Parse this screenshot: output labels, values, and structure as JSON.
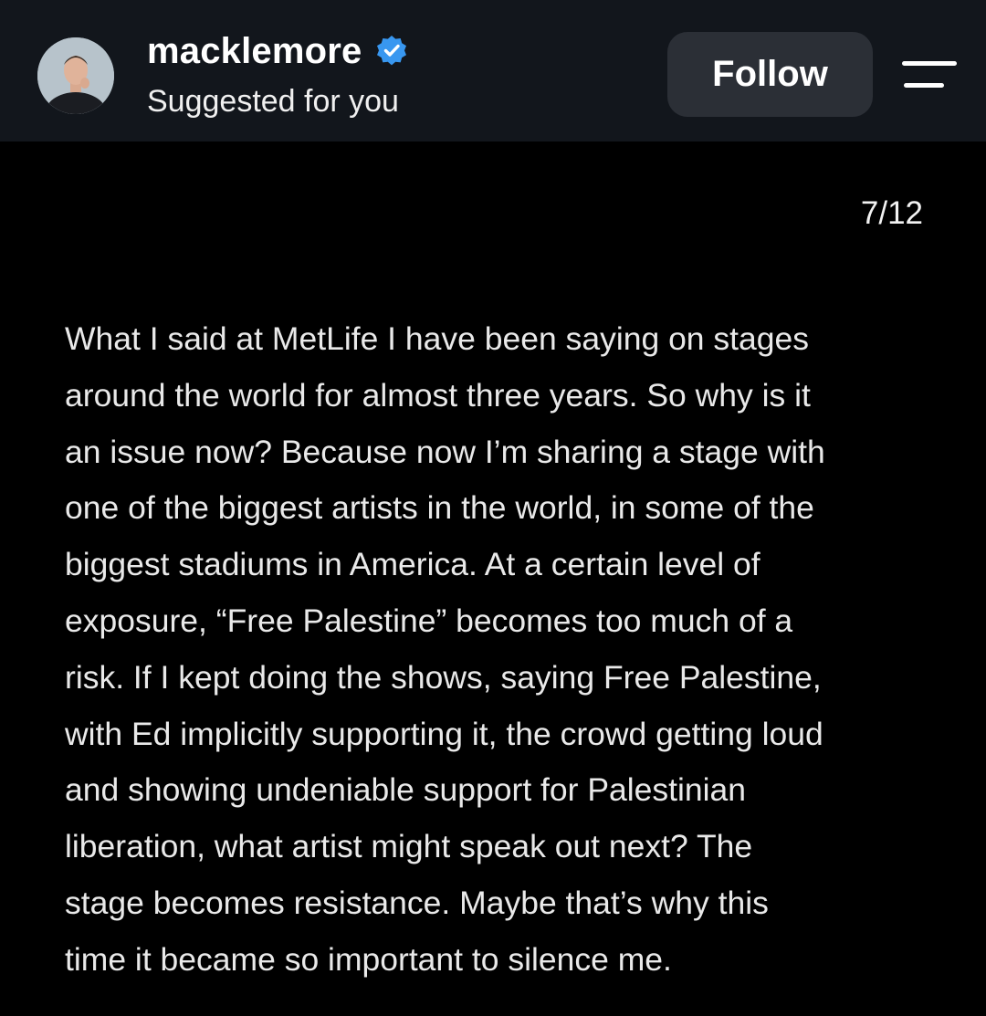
{
  "header": {
    "username": "macklemore",
    "verified": true,
    "subtitle": "Suggested for you",
    "follow_label": "Follow",
    "avatar_icon": "avatar-photo",
    "verified_icon": "verified-badge-icon",
    "menu_icon": "menu-icon",
    "colors": {
      "header_bg": "#12161c",
      "verified_blue": "#3897f0",
      "button_bg": "#2b2f36"
    }
  },
  "post": {
    "page_counter": "7/12",
    "text_lines": [
      "What I said at MetLife I have been saying on stages",
      "around the world for almost three years. So why is it",
      "an issue now? Because now I’m sharing a stage with",
      "one of the biggest artists in the world, in some of the",
      "biggest stadiums in America. At a certain level of",
      "exposure, “Free Palestine” becomes too much of a",
      "risk. If I kept doing the shows, saying Free Palestine,",
      "with Ed implicitly supporting it, the crowd getting loud",
      "and showing undeniable support for Palestinian",
      "liberation, what artist might speak out next? The",
      "stage becomes resistance. Maybe that’s why this",
      "time it became so important to silence me."
    ]
  }
}
